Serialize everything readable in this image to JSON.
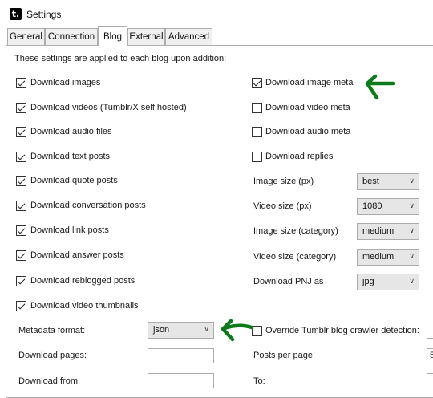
{
  "window": {
    "title": "Settings",
    "icon": "tumblr-logo-icon",
    "icon_glyph": "t."
  },
  "tabs": [
    {
      "label": "General",
      "active": false
    },
    {
      "label": "Connection",
      "active": false
    },
    {
      "label": "Blog",
      "active": true
    },
    {
      "label": "External",
      "active": false
    },
    {
      "label": "Advanced",
      "active": false
    }
  ],
  "blog": {
    "intro": "These settings are applied to each blog upon addition:",
    "left_checks": [
      {
        "label": "Download images",
        "checked": true
      },
      {
        "label": "Download videos (Tumblr/X self hosted)",
        "checked": true
      },
      {
        "label": "Download audio files",
        "checked": true
      },
      {
        "label": "Download text posts",
        "checked": true
      },
      {
        "label": "Download quote posts",
        "checked": true
      },
      {
        "label": "Download conversation posts",
        "checked": true
      },
      {
        "label": "Download link posts",
        "checked": true
      },
      {
        "label": "Download answer posts",
        "checked": true
      },
      {
        "label": "Download reblogged posts",
        "checked": true
      },
      {
        "label": "Download video thumbnails",
        "checked": true
      }
    ],
    "right_checks": [
      {
        "label": "Download image meta",
        "checked": true
      },
      {
        "label": "Download video meta",
        "checked": false
      },
      {
        "label": "Download audio meta",
        "checked": false
      },
      {
        "label": "Download replies",
        "checked": false
      }
    ],
    "combos": [
      {
        "label": "Image size (px)",
        "value": "best"
      },
      {
        "label": "Video size (px)",
        "value": "1080"
      },
      {
        "label": "Image size (category)",
        "value": "medium"
      },
      {
        "label": "Video size (category)",
        "value": "medium"
      },
      {
        "label": "Download PNJ as",
        "value": "jpg"
      }
    ],
    "metadata_format": {
      "label": "Metadata format:",
      "value": "json"
    },
    "override_crawler": {
      "label": "Override Tumblr blog crawler detection:",
      "checked": false
    },
    "download_pages": {
      "label": "Download pages:",
      "value": ""
    },
    "posts_per_page": {
      "label": "Posts per page:",
      "value": "5"
    },
    "download_from": {
      "label": "Download from:",
      "value": ""
    },
    "to": {
      "label": "To:",
      "value": ""
    }
  },
  "annotations": {
    "arrow_color": "#0b7a1a"
  }
}
